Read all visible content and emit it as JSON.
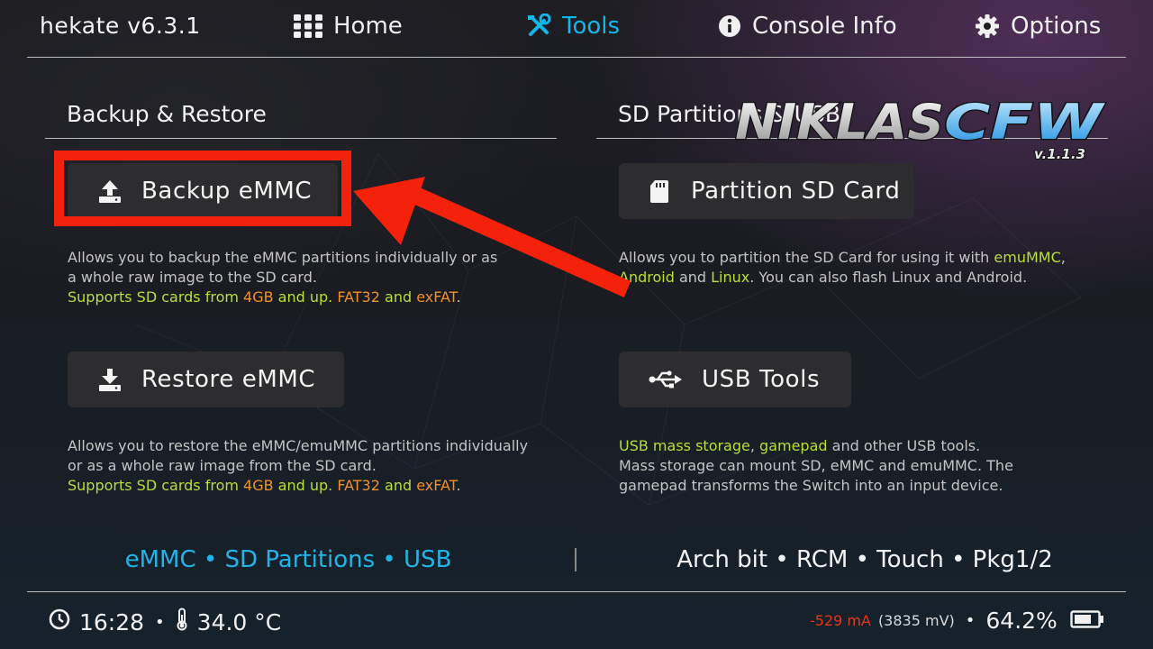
{
  "header": {
    "title": "hekate v6.3.1",
    "tabs": [
      {
        "label": "Home",
        "icon": "grid-icon"
      },
      {
        "label": "Tools",
        "icon": "tools-icon",
        "active": true
      },
      {
        "label": "Console Info",
        "icon": "info-icon"
      },
      {
        "label": "Options",
        "icon": "gear-icon"
      }
    ]
  },
  "sections": {
    "left_title": "Backup & Restore",
    "right_title": "SD Partitions & USB"
  },
  "buttons": {
    "backup": "Backup eMMC",
    "restore": "Restore eMMC",
    "partition": "Partition SD Card",
    "usb": "USB Tools"
  },
  "descriptions": {
    "backup": {
      "line1": "Allows you to backup the eMMC partitions individually or as",
      "line2": "a whole raw image to the SD card.",
      "s1": "Supports SD cards from ",
      "s2": "4GB",
      "s3": " and up. ",
      "s4": "FAT32",
      "s5": " and ",
      "s6": "exFAT",
      "s7": "."
    },
    "restore": {
      "line1": "Allows you to restore the eMMC/emuMMC partitions individually",
      "line2": "or as a whole raw image from the SD card.",
      "s1": "Supports SD cards from ",
      "s2": "4GB",
      "s3": " and up. ",
      "s4": "FAT32",
      "s5": " and ",
      "s6": "exFAT",
      "s7": "."
    },
    "partition": {
      "a1": "Allows you to partition the SD Card for using it with ",
      "a2": "emuMMC",
      "a3": ",",
      "b1": "Android",
      "b2": " and ",
      "b3": "Linux",
      "b4": ". You can also flash Linux and Android."
    },
    "usb": {
      "a1": "USB mass storage",
      "a2": ", ",
      "a3": "gamepad",
      "a4": " and other USB tools.",
      "line2": "Mass storage can mount SD, eMMC and emuMMC. The",
      "line3": "gamepad transforms the Switch into an input device."
    }
  },
  "footer": {
    "left": "eMMC • SD Partitions • USB",
    "right": "Arch bit • RCM • Touch • Pkg1/2"
  },
  "status": {
    "time": "16:28",
    "dot": "•",
    "temp": "34.0 °C",
    "current": "-529 mA",
    "voltage": "(3835 mV)",
    "battery": "64.2%"
  },
  "overlay": {
    "logo_text": "NIKLASCFW",
    "logo_version": "v.1.1.3",
    "highlight_color": "#f5210b"
  },
  "colors": {
    "accent": "#12b6e8",
    "green_text": "#b8de3c",
    "orange_text": "#f0912a",
    "red_text": "#e8341c"
  }
}
